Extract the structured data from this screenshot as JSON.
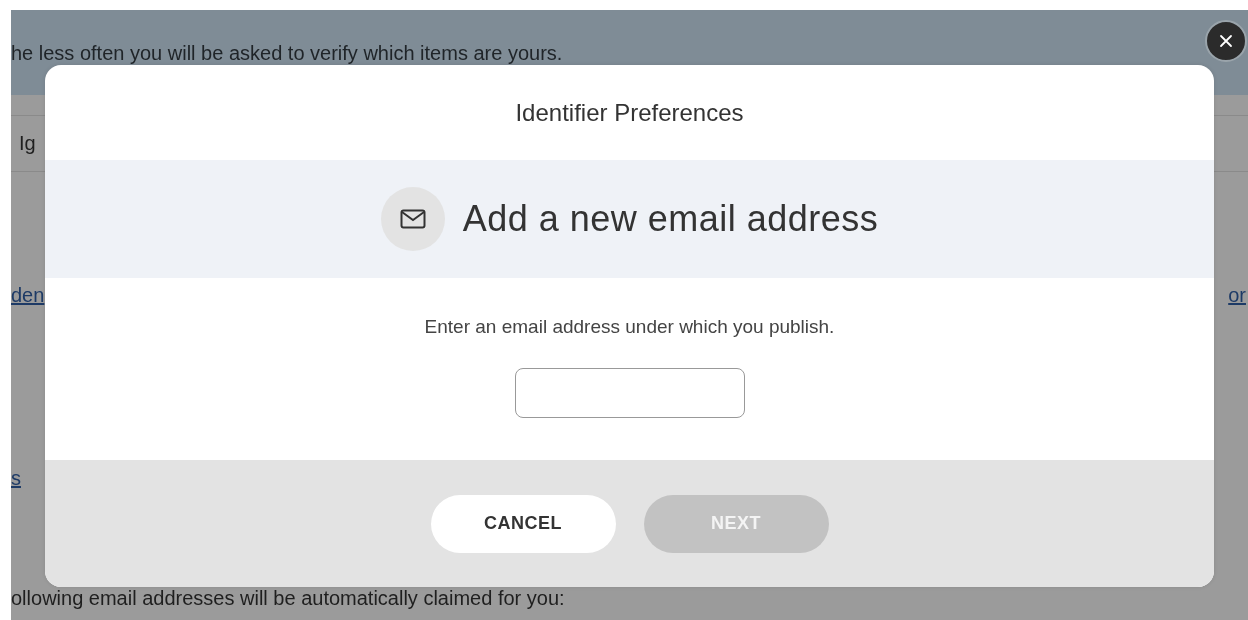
{
  "background_page": {
    "banner_text": "he less often you will be asked to verify which items are yours.",
    "tab_label": "Ig",
    "links": [
      {
        "text": "den"
      },
      {
        "text": "or"
      }
    ],
    "lower_link": "s",
    "footer_text": "ollowing email addresses will be automatically claimed for you:"
  },
  "dialog": {
    "title": "Identifier Preferences",
    "heading": "Add a new email address",
    "prompt": "Enter an email address under which you publish.",
    "buttons": [
      {
        "label": "CANCEL",
        "disabled": false
      },
      {
        "label": "NEXT",
        "disabled": true
      }
    ]
  }
}
